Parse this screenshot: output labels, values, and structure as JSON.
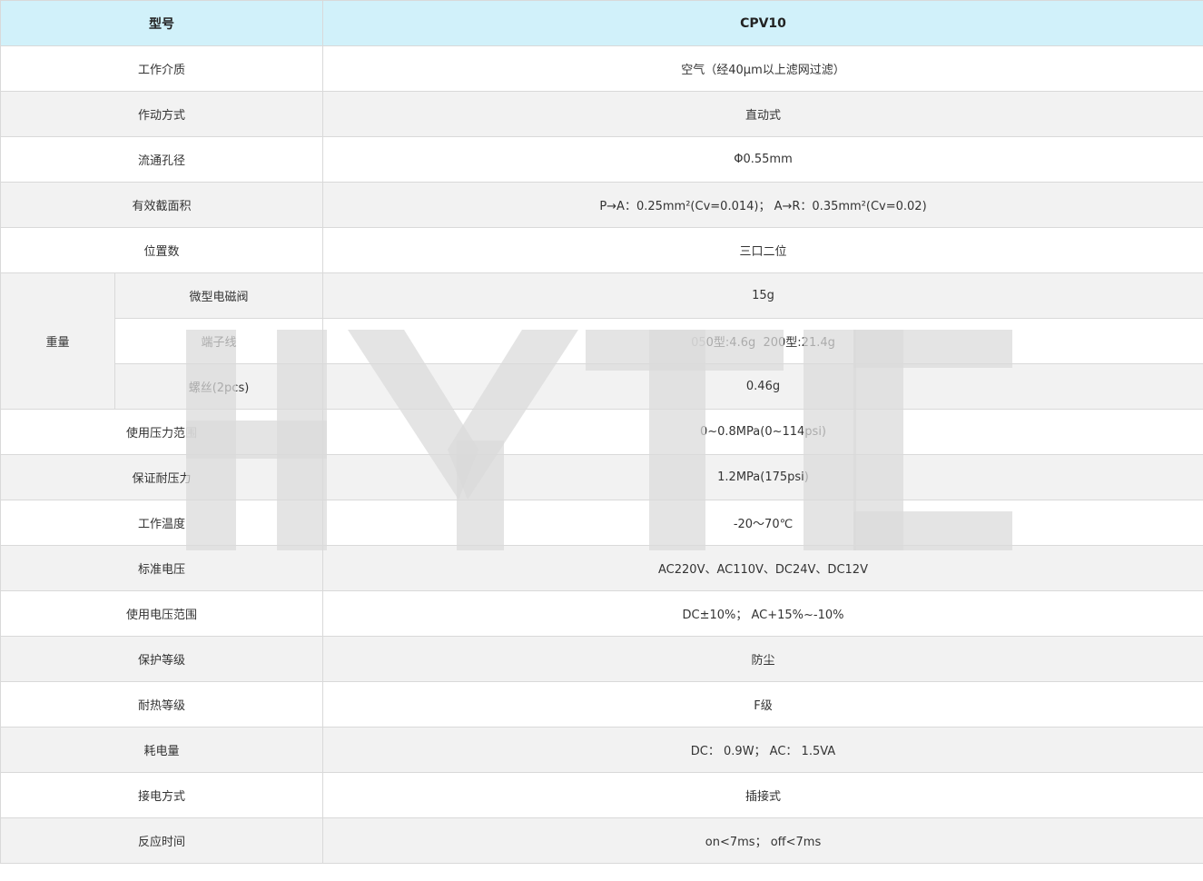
{
  "header": {
    "label": "型号",
    "value": "CPV10"
  },
  "rows": [
    {
      "label": "工作介质",
      "value": "空气（经40μm以上滤网过滤）"
    },
    {
      "label": "作动方式",
      "value": "直动式"
    },
    {
      "label": "流通孔径",
      "value": "Φ0.55mm"
    },
    {
      "label": "有效截面积",
      "value": "P→A：0.25mm²(Cv=0.014)； A→R：0.35mm²(Cv=0.02)"
    },
    {
      "label": "位置数",
      "value": "三口二位"
    }
  ],
  "weight": {
    "label": "重量",
    "items": [
      {
        "label": "微型电磁阀",
        "value": "15g"
      },
      {
        "label": "端子线",
        "value": "050型:4.6g  200型:21.4g"
      },
      {
        "label": "螺丝(2pcs)",
        "value": "0.46g"
      }
    ]
  },
  "rows2": [
    {
      "label": "使用压力范围",
      "value": "0~0.8MPa(0~114psi)"
    },
    {
      "label": "保证耐压力",
      "value": "1.2MPa(175psi)"
    },
    {
      "label": "工作温度",
      "value": "-20～70℃"
    },
    {
      "label": "标准电压",
      "value": "AC220V、AC110V、DC24V、DC12V"
    },
    {
      "label": "使用电压范围",
      "value": "DC±10%； AC+15%~-10%"
    },
    {
      "label": "保护等级",
      "value": "防尘"
    },
    {
      "label": "耐热等级",
      "value": "F级"
    },
    {
      "label": "耗电量",
      "value": "DC： 0.9W； AC： 1.5VA"
    },
    {
      "label": "接电方式",
      "value": "插接式"
    },
    {
      "label": "反应时间",
      "value": "on<7ms； off<7ms"
    }
  ],
  "watermark": {
    "text": "HYTIC",
    "color": "#d9d9d9"
  },
  "colors": {
    "header_bg": "#d1f1fa",
    "alt_row_bg": "#f2f2f2",
    "border": "#d9d9d9"
  }
}
